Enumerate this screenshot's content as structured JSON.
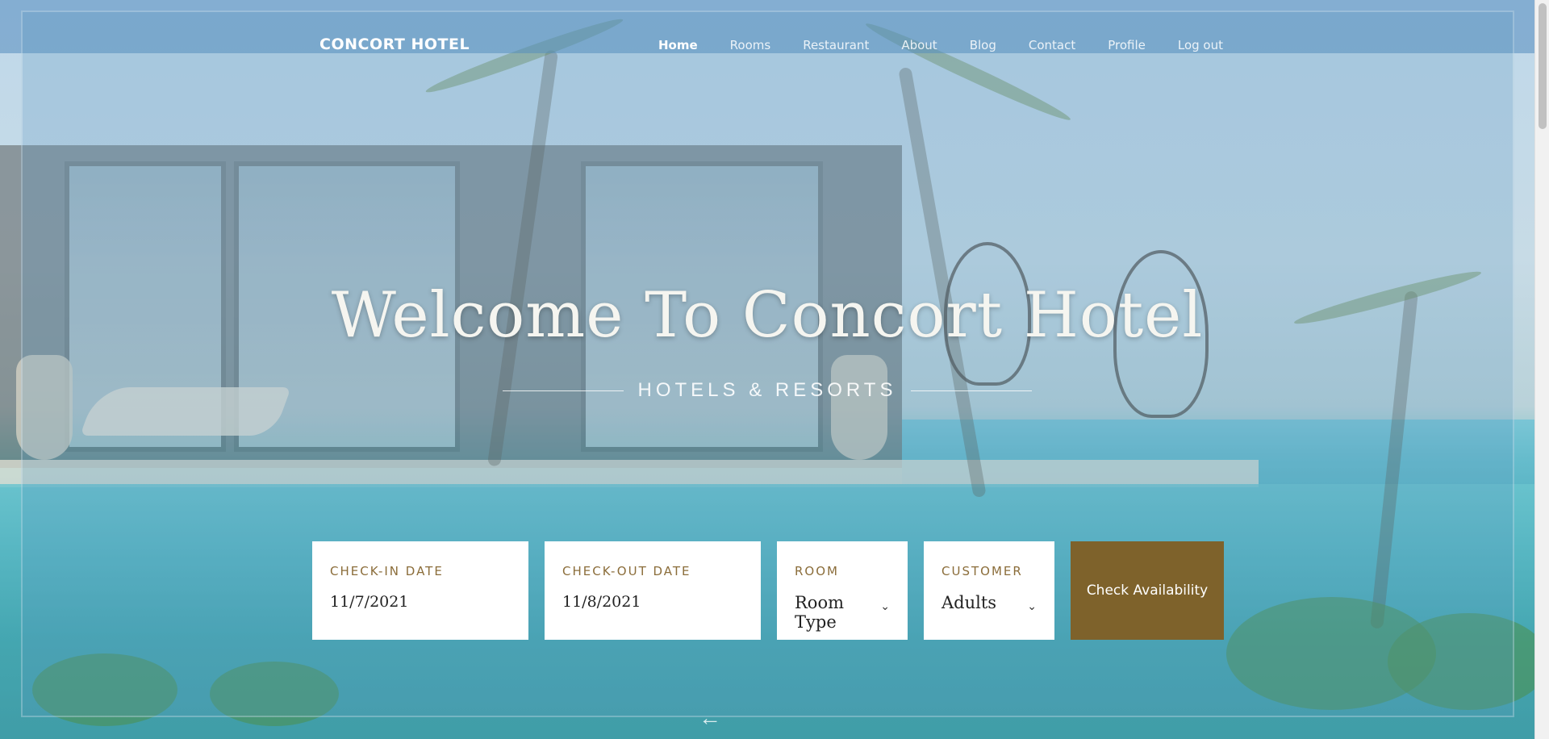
{
  "brand": {
    "name": "CONCORT HOTEL"
  },
  "nav": {
    "items": [
      {
        "label": "Home",
        "active": true
      },
      {
        "label": "Rooms",
        "active": false
      },
      {
        "label": "Restaurant",
        "active": false
      },
      {
        "label": "About",
        "active": false
      },
      {
        "label": "Blog",
        "active": false
      },
      {
        "label": "Contact",
        "active": false
      },
      {
        "label": "Profile",
        "active": false
      },
      {
        "label": "Log out",
        "active": false
      }
    ]
  },
  "hero": {
    "title": "Welcome To Concort Hotel",
    "subtitle": "HOTELS & RESORTS"
  },
  "booking": {
    "checkin": {
      "label": "CHECK-IN DATE",
      "value": "11/7/2021"
    },
    "checkout": {
      "label": "CHECK-OUT DATE",
      "value": "11/8/2021"
    },
    "room": {
      "label": "ROOM",
      "value": "Room Type"
    },
    "customer": {
      "label": "CUSTOMER",
      "value": "Adults"
    },
    "button_label": "Check Availability"
  },
  "icons": {
    "chevron": "chevron-down-icon",
    "arrow": "arrow-left-icon"
  },
  "colors": {
    "accent": "#7e622b",
    "label": "#8b6d3a"
  }
}
